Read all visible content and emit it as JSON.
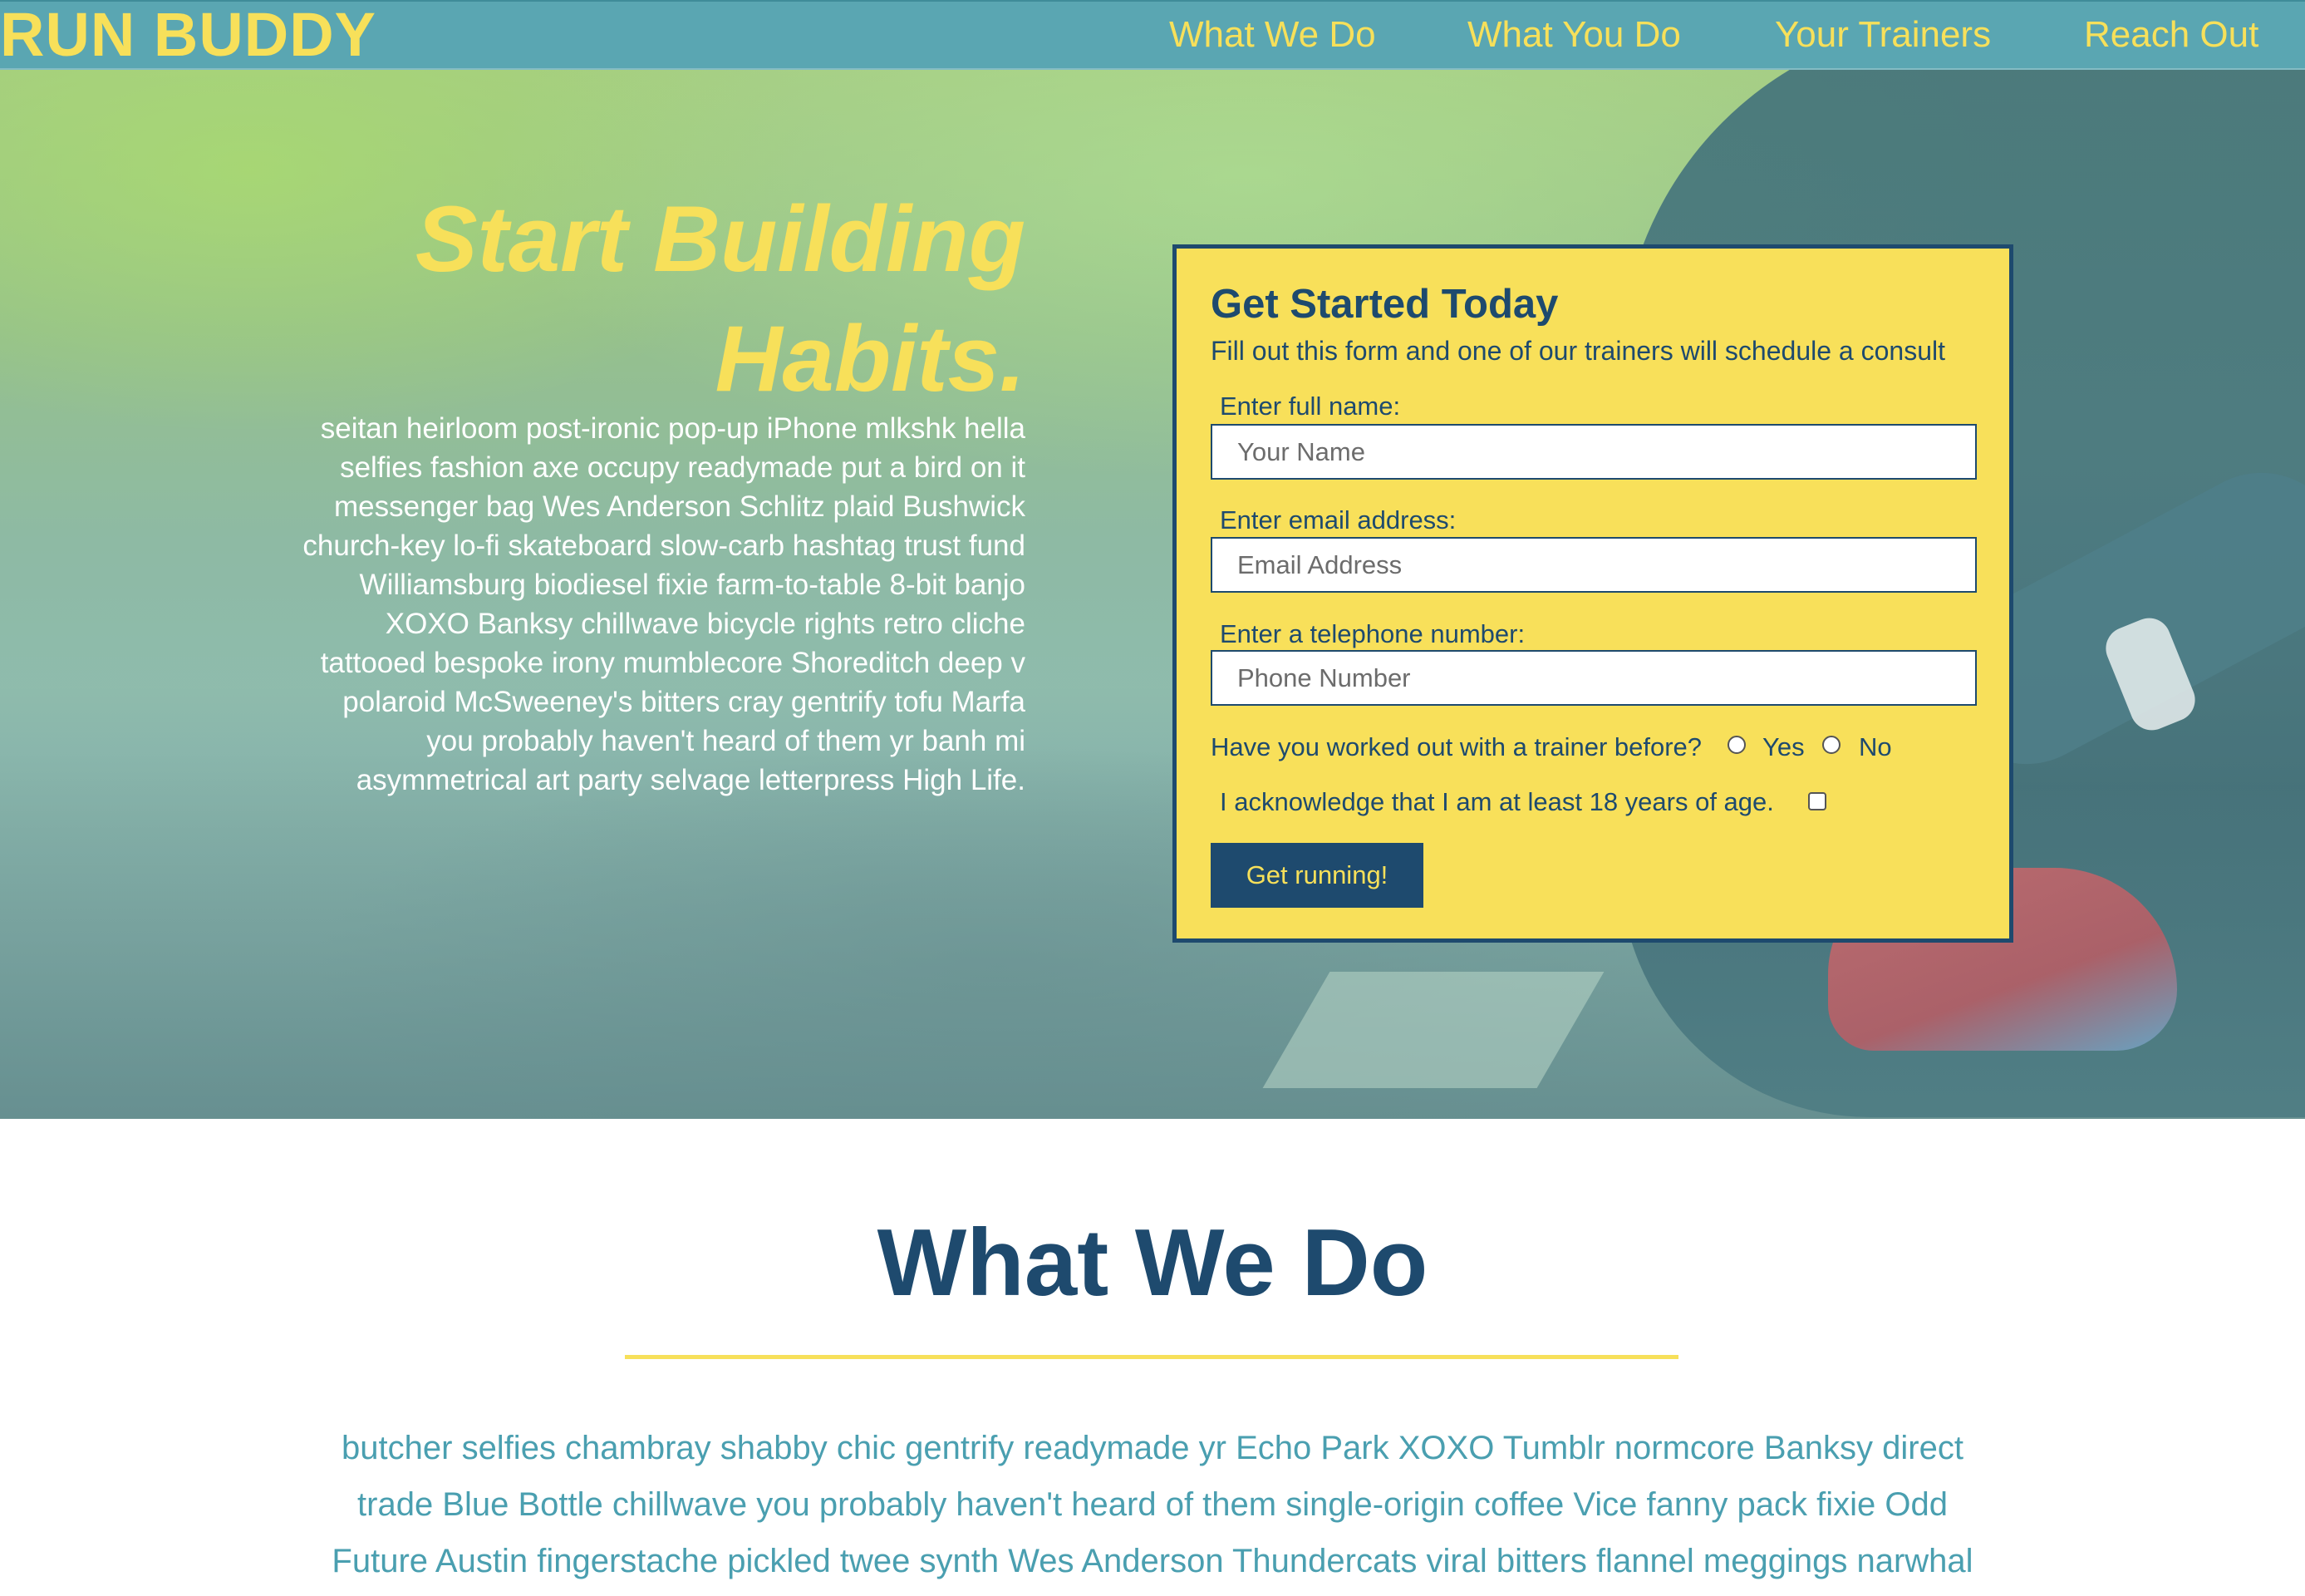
{
  "header": {
    "logo": "RUN BUDDY",
    "nav": [
      "What We Do",
      "What You Do",
      "Your Trainers",
      "Reach Out"
    ]
  },
  "hero": {
    "title": "Start Building Habits.",
    "body": "seitan heirloom post-ironic pop-up iPhone mlkshk hella selfies fashion axe occupy readymade put a bird on it messenger bag Wes Anderson Schlitz plaid Bushwick church-key lo-fi skateboard slow-carb hashtag trust fund Williamsburg biodiesel fixie farm-to-table 8-bit banjo XOXO Banksy chillwave bicycle rights retro cliche tattooed bespoke irony mumblecore Shoreditch deep v polaroid McSweeney's bitters cray gentrify tofu Marfa you probably haven't heard of them yr banh mi asymmetrical art party selvage letterpress High Life."
  },
  "form": {
    "title": "Get Started Today",
    "subtitle": "Fill out this form and one of our trainers will schedule a consult",
    "name_label": "Enter full name:",
    "name_placeholder": "Your Name",
    "email_label": "Enter email address:",
    "email_placeholder": "Email Address",
    "phone_label": "Enter a telephone number:",
    "phone_placeholder": "Phone Number",
    "trainer_question": "Have you worked out with a trainer before?",
    "yes_label": "Yes",
    "no_label": "No",
    "age_ack": "I acknowledge that I am at least 18 years of age.",
    "submit_label": "Get running!"
  },
  "what_we_do": {
    "title": "What We Do",
    "body": "butcher selfies chambray shabby chic gentrify readymade yr Echo Park XOXO Tumblr normcore Banksy direct trade Blue Bottle chillwave you probably haven't heard of them single-origin coffee Vice fanny pack fixie Odd Future Austin fingerstache pickled twee synth Wes Anderson Thundercats viral bitters flannel meggings narwhal"
  },
  "colors": {
    "header_bg": "#5aa6b2",
    "accent_yellow": "#f7e05a",
    "navy": "#1e4a6e",
    "teal_text": "#4a9fb0"
  }
}
